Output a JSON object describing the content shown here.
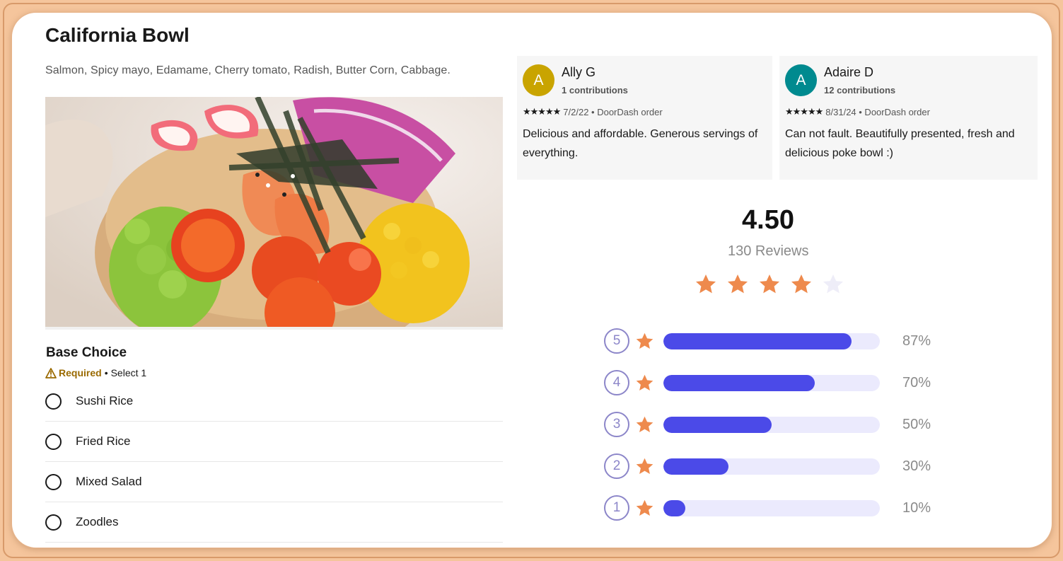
{
  "item": {
    "title": "California Bowl",
    "description": "Salmon, Spicy mayo, Edamame, Cherry tomato, Radish, Butter Corn, Cabbage."
  },
  "base_choice": {
    "title": "Base Choice",
    "required_label": "Required",
    "select_label": "Select 1",
    "options": [
      "Sushi Rice",
      "Fried Rice",
      "Mixed Salad",
      "Zoodles"
    ]
  },
  "reviews": [
    {
      "initial": "A",
      "avatar_color": "#c9a400",
      "name": "Ally G",
      "contributions": "1 contributions",
      "stars": "★★★★★",
      "meta": "7/2/22 • DoorDash order",
      "text": "Delicious and affordable. Generous servings of everything."
    },
    {
      "initial": "A",
      "avatar_color": "#008a8f",
      "name": "Adaire D",
      "contributions": "12 contributions",
      "stars": "★★★★★",
      "meta": "8/31/24 • DoorDash order",
      "text": "Can not fault. Beautifully presented, fresh and delicious poke bowl :)"
    }
  ],
  "rating_summary": {
    "average": "4.50",
    "count_label": "130 Reviews",
    "stars_filled": 4,
    "stars_total": 5,
    "star_color": "#ee8a4d",
    "star_empty_color": "#eeedf8",
    "bar_color": "#4b4ae8",
    "breakdown": [
      {
        "stars": "5",
        "percent": 87,
        "label": "87%"
      },
      {
        "stars": "4",
        "percent": 70,
        "label": "70%"
      },
      {
        "stars": "3",
        "percent": 50,
        "label": "50%"
      },
      {
        "stars": "2",
        "percent": 30,
        "label": "30%"
      },
      {
        "stars": "1",
        "percent": 10,
        "label": "10%"
      }
    ]
  }
}
